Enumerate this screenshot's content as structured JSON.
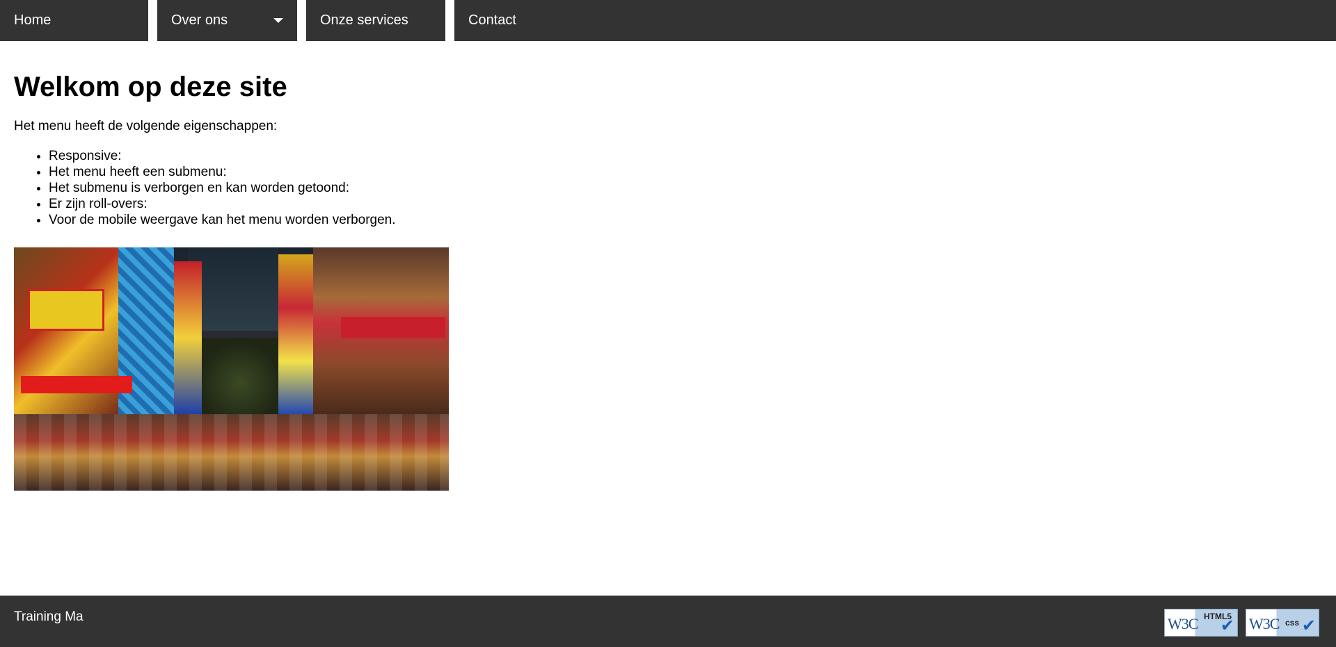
{
  "nav": {
    "items": [
      {
        "label": "Home"
      },
      {
        "label": "Over ons",
        "has_submenu": true
      },
      {
        "label": "Onze services"
      },
      {
        "label": "Contact"
      }
    ]
  },
  "main": {
    "title": "Welkom op deze site",
    "intro": "Het menu heeft de volgende eigenschappen:",
    "features": [
      "Responsive:",
      "Het menu heeft een submenu:",
      "Het submenu is verborgen en kan worden getoond:",
      "Er zijn roll-overs:",
      "Voor de mobile weergave kan het menu worden verborgen."
    ]
  },
  "footer": {
    "text": "Training Ma",
    "badges": [
      {
        "logo": "W3C",
        "label": "HTML5",
        "icon": "check-icon"
      },
      {
        "logo": "W3C",
        "label": "css",
        "icon": "check-icon"
      }
    ]
  },
  "colors": {
    "nav_background": "#333333",
    "footer_background": "#333333",
    "text_on_dark": "#ffffff",
    "page_background": "#ffffff"
  }
}
